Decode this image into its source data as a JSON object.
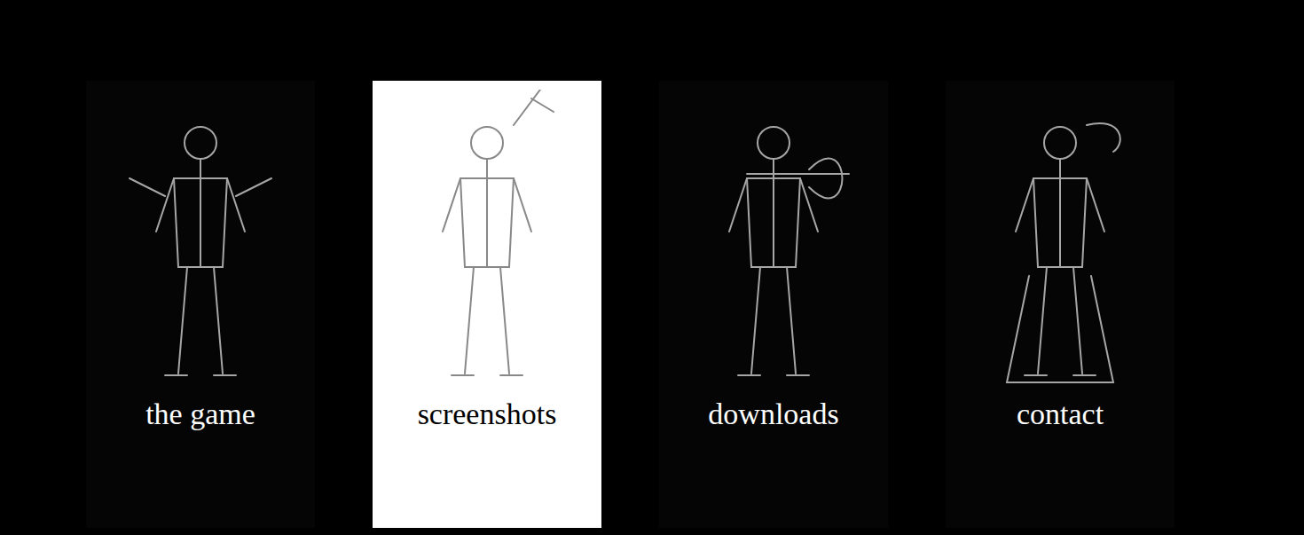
{
  "nav": {
    "items": [
      {
        "label": "the game",
        "selected": false
      },
      {
        "label": "screenshots",
        "selected": true
      },
      {
        "label": "downloads",
        "selected": false
      },
      {
        "label": "contact",
        "selected": false
      }
    ]
  }
}
